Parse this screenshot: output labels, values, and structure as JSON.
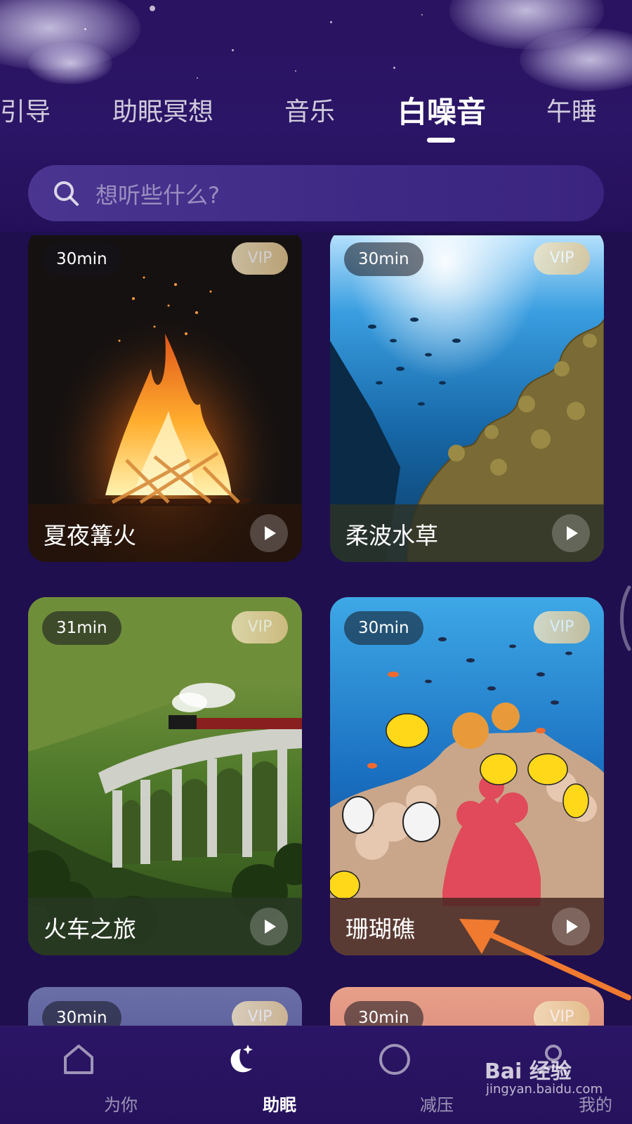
{
  "tabs": {
    "items": [
      "引导",
      "助眠冥想",
      "音乐",
      "白噪音",
      "午睡"
    ],
    "active": "白噪音"
  },
  "search": {
    "placeholder": "想听些什么?"
  },
  "cards": [
    {
      "title": "夏夜篝火",
      "duration": "30min",
      "vip": "VIP",
      "scene": "campfire"
    },
    {
      "title": "柔波水草",
      "duration": "30min",
      "vip": "VIP",
      "scene": "underwater-seaweed"
    },
    {
      "title": "火车之旅",
      "duration": "31min",
      "vip": "VIP",
      "scene": "train-viaduct"
    },
    {
      "title": "珊瑚礁",
      "duration": "30min",
      "vip": "VIP",
      "scene": "coral-reef"
    },
    {
      "title": "",
      "duration": "30min",
      "vip": "VIP",
      "scene": "sky"
    },
    {
      "title": "",
      "duration": "30min",
      "vip": "VIP",
      "scene": "sunset"
    }
  ],
  "bottom_nav": {
    "items": [
      {
        "label": "为你",
        "icon": "home-icon"
      },
      {
        "label": "助眠",
        "icon": "moon-star-icon"
      },
      {
        "label": "减压",
        "icon": "circle-icon"
      },
      {
        "label": "我的",
        "icon": "user-icon"
      }
    ],
    "active": "助眠"
  },
  "watermark": {
    "text": "Bai 经验",
    "sub": "jingyan.baidu.com"
  },
  "colors": {
    "background": "#1f0f4f",
    "accent_annotation": "#f07a30",
    "vip_gold": "#e4c690"
  }
}
